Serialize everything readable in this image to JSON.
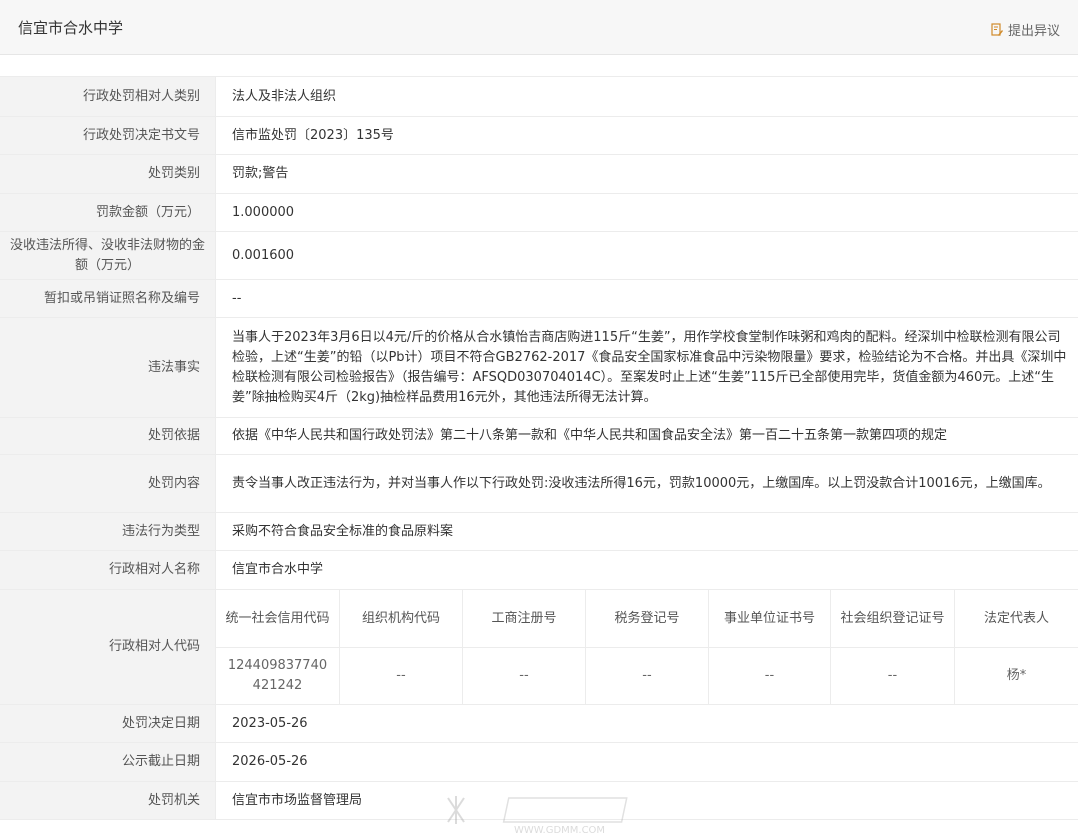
{
  "header": {
    "title": "信宜市合水中学",
    "objection_label": "提出异议"
  },
  "rows": {
    "party_type": {
      "label": "行政处罚相对人类别",
      "value": "法人及非法人组织"
    },
    "decision_no": {
      "label": "行政处罚决定书文号",
      "value": "信市监处罚〔2023〕135号"
    },
    "penalty_category": {
      "label": "处罚类别",
      "value": "罚款;警告"
    },
    "fine_amount": {
      "label": "罚款金额（万元）",
      "value": "1.000000"
    },
    "confiscation": {
      "label": "没收违法所得、没收非法财物的金额（万元）",
      "value": "0.001600"
    },
    "license_revoke": {
      "label": "暂扣或吊销证照名称及编号",
      "value": "--"
    },
    "violation_facts": {
      "label": "违法事实",
      "value": "当事人于2023年3月6日以4元/斤的价格从合水镇怡吉商店购进115斤“生姜”，用作学校食堂制作味粥和鸡肉的配料。经深圳中检联检测有限公司检验，上述“生姜”的铅（以Pb计）项目不符合GB2762-2017《食品安全国家标准食品中污染物限量》要求，检验结论为不合格。并出具《深圳中检联检测有限公司检验报告》（报告编号：AFSQD030704014C）。至案发时止上述“生姜”115斤已全部使用完毕，货值金额为460元。上述“生姜”除抽检购买4斤（2kg)抽检样品费用16元外，其他违法所得无法计算。"
    },
    "legal_basis": {
      "label": "处罚依据",
      "value": "依据《中华人民共和国行政处罚法》第二十八条第一款和《中华人民共和国食品安全法》第一百二十五条第一款第四项的规定"
    },
    "penalty_content": {
      "label": "处罚内容",
      "value": "责令当事人改正违法行为，并对当事人作以下行政处罚:没收违法所得16元，罚款10000元，上缴国库。以上罚没款合计10016元，上缴国库。"
    },
    "violation_type": {
      "label": "违法行为类型",
      "value": "采购不符合食品安全标准的食品原料案"
    },
    "party_name": {
      "label": "行政相对人名称",
      "value": "信宜市合水中学"
    },
    "party_code": {
      "label": "行政相对人代码",
      "headers": [
        "统一社会信用代码",
        "组织机构代码",
        "工商注册号",
        "税务登记号",
        "事业单位证书号",
        "社会组织登记证号",
        "法定代表人"
      ],
      "values": [
        "124409837740421242",
        "--",
        "--",
        "--",
        "--",
        "--",
        "杨*"
      ]
    },
    "decision_date": {
      "label": "处罚决定日期",
      "value": "2023-05-26"
    },
    "publicity_deadline": {
      "label": "公示截止日期",
      "value": "2026-05-26"
    },
    "authority": {
      "label": "处罚机关",
      "value": "信宜市市场监督管理局"
    }
  },
  "watermark": {
    "text": "WWW.GDMM.COM"
  }
}
